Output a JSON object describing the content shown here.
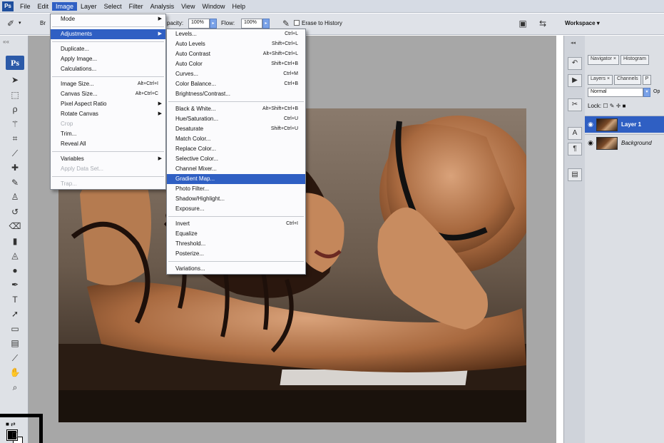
{
  "menubar": {
    "items": [
      "File",
      "Edit",
      "Image",
      "Layer",
      "Select",
      "Filter",
      "Analysis",
      "View",
      "Window",
      "Help"
    ],
    "active_index": 2
  },
  "options_bar": {
    "brush_label": "Br",
    "opacity_label": "pacity:",
    "opacity_value": "100%",
    "flow_label": "Flow:",
    "flow_value": "100%",
    "erase_to_history": "Erase to History",
    "workspace_label": "Workspace ▾"
  },
  "toolbox": {
    "logo": "Ps",
    "tool_icons": [
      "move-icon",
      "marquee-icon",
      "lasso-icon",
      "magic-wand-icon",
      "crop-icon",
      "slice-icon",
      "healing-brush-icon",
      "brush-icon",
      "clone-stamp-icon",
      "history-brush-icon",
      "eraser-icon",
      "gradient-icon",
      "blur-icon",
      "dodge-icon",
      "pen-icon",
      "type-icon",
      "path-selection-icon",
      "shape-icon",
      "notes-icon",
      "eyedropper-icon",
      "hand-icon",
      "zoom-icon"
    ]
  },
  "image_menu": {
    "items": [
      {
        "label": "Mode",
        "shortcut": "",
        "submenu": true,
        "state": "normal"
      },
      {
        "sep": true
      },
      {
        "label": "Adjustments",
        "shortcut": "",
        "submenu": true,
        "state": "selected"
      },
      {
        "sep": true
      },
      {
        "label": "Duplicate...",
        "shortcut": "",
        "submenu": false,
        "state": "normal"
      },
      {
        "label": "Apply Image...",
        "shortcut": "",
        "submenu": false,
        "state": "normal"
      },
      {
        "label": "Calculations...",
        "shortcut": "",
        "submenu": false,
        "state": "normal"
      },
      {
        "sep": true
      },
      {
        "label": "Image Size...",
        "shortcut": "Alt+Ctrl+I",
        "submenu": false,
        "state": "normal"
      },
      {
        "label": "Canvas Size...",
        "shortcut": "Alt+Ctrl+C",
        "submenu": false,
        "state": "normal"
      },
      {
        "label": "Pixel Aspect Ratio",
        "shortcut": "",
        "submenu": true,
        "state": "normal"
      },
      {
        "label": "Rotate Canvas",
        "shortcut": "",
        "submenu": true,
        "state": "normal"
      },
      {
        "label": "Crop",
        "shortcut": "",
        "submenu": false,
        "state": "disabled"
      },
      {
        "label": "Trim...",
        "shortcut": "",
        "submenu": false,
        "state": "normal"
      },
      {
        "label": "Reveal All",
        "shortcut": "",
        "submenu": false,
        "state": "normal"
      },
      {
        "sep": true
      },
      {
        "label": "Variables",
        "shortcut": "",
        "submenu": true,
        "state": "normal"
      },
      {
        "label": "Apply Data Set...",
        "shortcut": "",
        "submenu": false,
        "state": "disabled"
      },
      {
        "sep": true
      },
      {
        "label": "Trap...",
        "shortcut": "",
        "submenu": false,
        "state": "disabled"
      }
    ]
  },
  "adjustments_menu": {
    "items": [
      {
        "label": "Levels...",
        "shortcut": "Ctrl+L",
        "state": "normal"
      },
      {
        "label": "Auto Levels",
        "shortcut": "Shift+Ctrl+L",
        "state": "normal"
      },
      {
        "label": "Auto Contrast",
        "shortcut": "Alt+Shift+Ctrl+L",
        "state": "normal"
      },
      {
        "label": "Auto Color",
        "shortcut": "Shift+Ctrl+B",
        "state": "normal"
      },
      {
        "label": "Curves...",
        "shortcut": "Ctrl+M",
        "state": "normal"
      },
      {
        "label": "Color Balance...",
        "shortcut": "Ctrl+B",
        "state": "normal"
      },
      {
        "label": "Brightness/Contrast...",
        "shortcut": "",
        "state": "normal"
      },
      {
        "sep": true
      },
      {
        "label": "Black & White...",
        "shortcut": "Alt+Shift+Ctrl+B",
        "state": "normal"
      },
      {
        "label": "Hue/Saturation...",
        "shortcut": "Ctrl+U",
        "state": "normal"
      },
      {
        "label": "Desaturate",
        "shortcut": "Shift+Ctrl+U",
        "state": "normal"
      },
      {
        "label": "Match Color...",
        "shortcut": "",
        "state": "normal"
      },
      {
        "label": "Replace Color...",
        "shortcut": "",
        "state": "normal"
      },
      {
        "label": "Selective Color...",
        "shortcut": "",
        "state": "normal"
      },
      {
        "label": "Channel Mixer...",
        "shortcut": "",
        "state": "normal"
      },
      {
        "label": "Gradient Map...",
        "shortcut": "",
        "state": "selected"
      },
      {
        "label": "Photo Filter...",
        "shortcut": "",
        "state": "normal"
      },
      {
        "label": "Shadow/Highlight...",
        "shortcut": "",
        "state": "normal"
      },
      {
        "label": "Exposure...",
        "shortcut": "",
        "state": "normal"
      },
      {
        "sep": true
      },
      {
        "label": "Invert",
        "shortcut": "Ctrl+I",
        "state": "normal"
      },
      {
        "label": "Equalize",
        "shortcut": "",
        "state": "normal"
      },
      {
        "label": "Threshold...",
        "shortcut": "",
        "state": "normal"
      },
      {
        "label": "Posterize...",
        "shortcut": "",
        "state": "normal"
      },
      {
        "sep": true
      },
      {
        "label": "Variations...",
        "shortcut": "",
        "state": "normal"
      }
    ]
  },
  "panels": {
    "top_tabs": [
      "Navigator ×",
      "Histogram"
    ],
    "layer_tabs": [
      "Layers ×",
      "Channels",
      "P"
    ],
    "blend_mode": "Normal",
    "opacity_label": "Op",
    "lock_label": "Lock:",
    "layers": [
      {
        "name": "Layer 1",
        "selected": true
      },
      {
        "name": "Background",
        "selected": false
      }
    ]
  },
  "colors": {
    "accent": "#2f5fc3",
    "workspace": "#a7a7a7"
  }
}
